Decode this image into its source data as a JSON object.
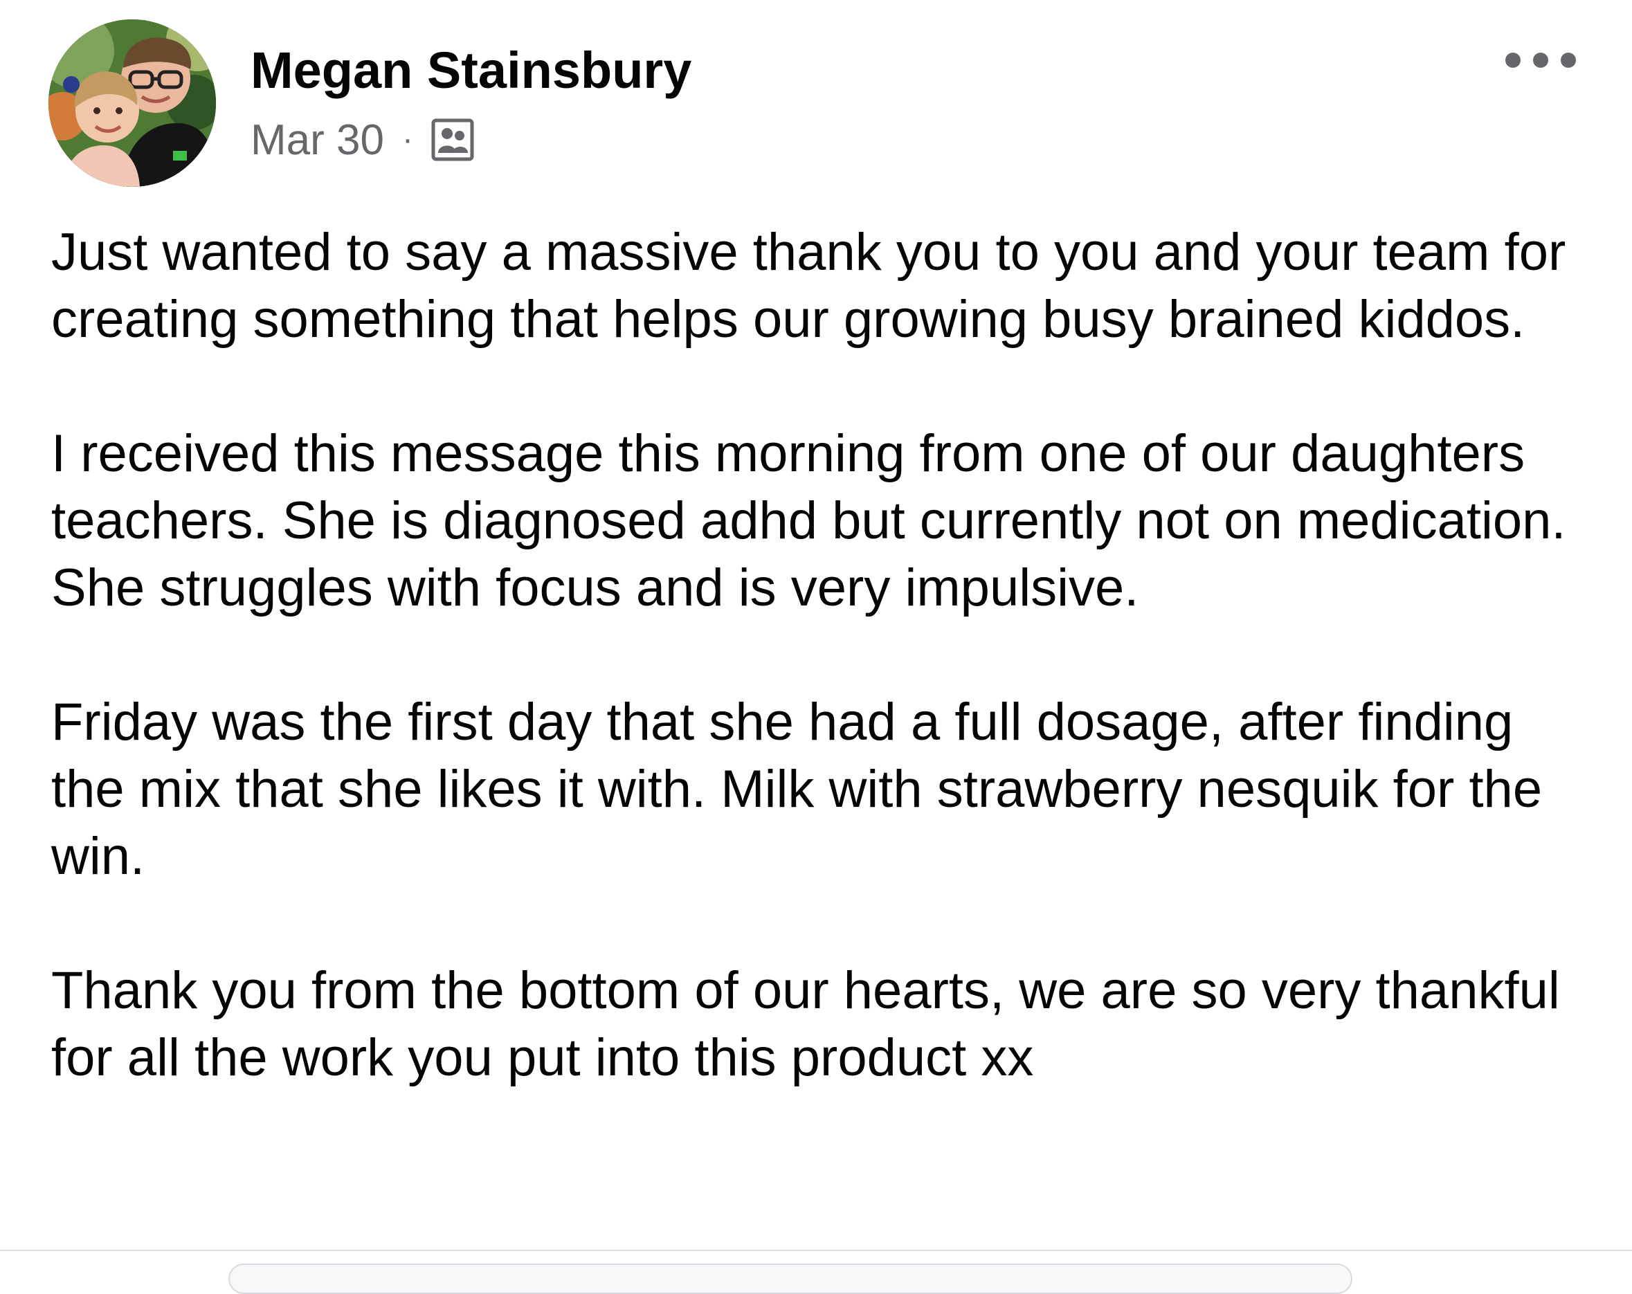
{
  "post": {
    "author": {
      "name": "Megan Stainsbury",
      "avatar_icon": "profile-photo-two-children"
    },
    "meta": {
      "date": "Mar 30",
      "separator": "·",
      "audience_icon": "group-members-icon"
    },
    "more_icon": "more-options-icon",
    "body": {
      "paragraph_1": "Just wanted to say a massive thank you to you and your team for creating something that helps our growing busy brained kiddos.",
      "paragraph_2": "I received this message this morning from one of our daughters teachers. She is diagnosed adhd but currently not on medication. She struggles with focus and is very impulsive.",
      "paragraph_3": "Friday was the first day that she had a full dosage, after finding the mix that she likes it with. Milk with strawberry nesquik for the win.",
      "paragraph_4": "Thank you from the bottom of our hearts, we are so very thankful for all the work you put into this product xx"
    }
  },
  "colors": {
    "text_primary": "#050505",
    "text_secondary": "#65676b",
    "divider": "#dadde1"
  }
}
